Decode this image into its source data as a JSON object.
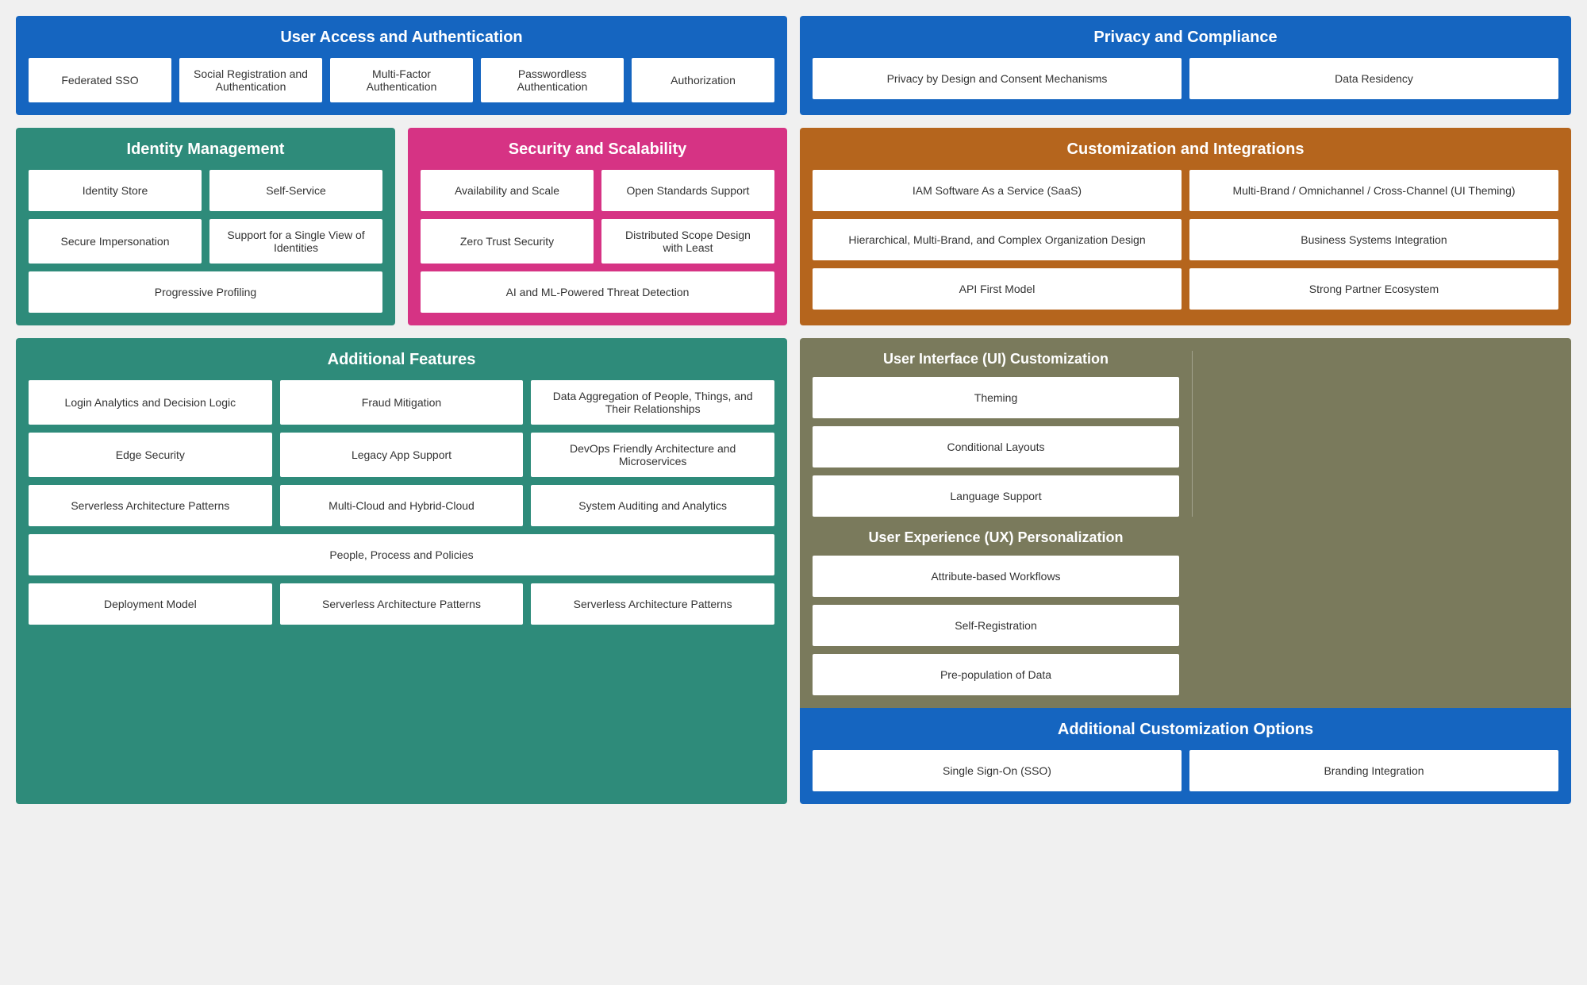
{
  "sections": {
    "uaa": {
      "title": "User Access and Authentication",
      "cards": [
        "Federated SSO",
        "Social Registration and Authentication",
        "Multi-Factor Authentication",
        "Passwordless Authentication",
        "Authorization"
      ]
    },
    "pac": {
      "title": "Privacy and Compliance",
      "cards": [
        "Privacy by Design and Consent Mechanisms",
        "Data Residency"
      ]
    },
    "im": {
      "title": "Identity Management",
      "cards": [
        "Identity Store",
        "Self-Service",
        "Secure Impersonation",
        "Support for a Single View of Identities",
        "Progressive Profiling"
      ]
    },
    "ss": {
      "title": "Security and Scalability",
      "cards": [
        "Availability and Scale",
        "Open Standards Support",
        "Zero Trust Security",
        "Distributed Scope Design with Least",
        "AI and ML-Powered Threat Detection"
      ]
    },
    "ci": {
      "title": "Customization and Integrations",
      "cards": [
        "IAM Software As a Service (SaaS)",
        "Multi-Brand / Omnichannel / Cross-Channel (UI Theming)",
        "Hierarchical, Multi-Brand, and Complex Organization Design",
        "Business Systems Integration",
        "API First Model",
        "Strong Partner Ecosystem"
      ]
    },
    "af": {
      "title": "Additional Features",
      "cards": [
        "Login Analytics and Decision Logic",
        "Fraud Mitigation",
        "Data Aggregation of People, Things, and Their Relationships",
        "Edge Security",
        "Legacy App Support",
        "DevOps Friendly Architecture and Microservices",
        "Serverless Architecture Patterns",
        "Multi-Cloud and Hybrid-Cloud",
        "System Auditing and Analytics",
        "People, Process and Policies",
        "Deployment Model",
        "Serverless Architecture Patterns",
        "Serverless Architecture Patterns"
      ]
    },
    "ui": {
      "title": "User Interface (UI) Customization",
      "cards": [
        "Theming",
        "Conditional Layouts",
        "Language Support"
      ]
    },
    "ux": {
      "title": "User Experience (UX) Personalization",
      "cards": [
        "Attribute-based Workflows",
        "Self-Registration",
        "Pre-population of Data"
      ]
    },
    "aco": {
      "title": "Additional Customization Options",
      "cards": [
        "Single Sign-On (SSO)",
        "Branding Integration"
      ]
    }
  }
}
